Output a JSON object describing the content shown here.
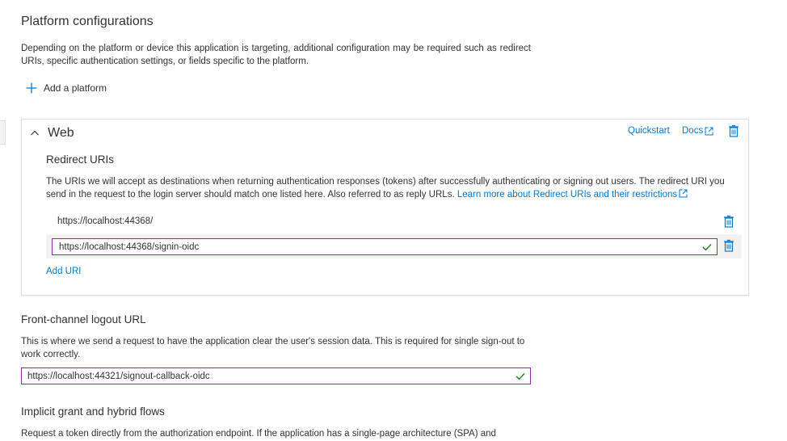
{
  "platform_section": {
    "title": "Platform configurations",
    "description": "Depending on the platform or device this application is targeting, additional configuration may be required such as redirect URIs, specific authentication settings, or fields specific to the platform.",
    "add_platform_label": "Add a platform"
  },
  "web_card": {
    "title": "Web",
    "quickstart_label": "Quickstart",
    "docs_label": "Docs",
    "redirect_title": "Redirect URIs",
    "redirect_description": "The URIs we will accept as destinations when returning authentication responses (tokens) after successfully authenticating or signing out users. The redirect URI you send in the request to the login server should match one listed here. Also referred to as reply URLs.",
    "learn_more_label": "Learn more about Redirect URIs and their restrictions",
    "redirect_uris": [
      "https://localhost:44368/",
      "https://localhost:44368/signin-oidc"
    ],
    "add_uri_label": "Add URI"
  },
  "front_channel": {
    "title": "Front-channel logout URL",
    "description": "This is where we send a request to have the application clear the user's session data. This is required for single sign-out to work correctly.",
    "value": "https://localhost:44321/signout-callback-oidc"
  },
  "implicit": {
    "title": "Implicit grant and hybrid flows",
    "description": "Request a token directly from the authorization endpoint. If the application has a single-page architecture (SPA) and"
  },
  "colors": {
    "accent": "#0078d4",
    "success": "#107c10",
    "focus_border": "#8a2da5"
  }
}
